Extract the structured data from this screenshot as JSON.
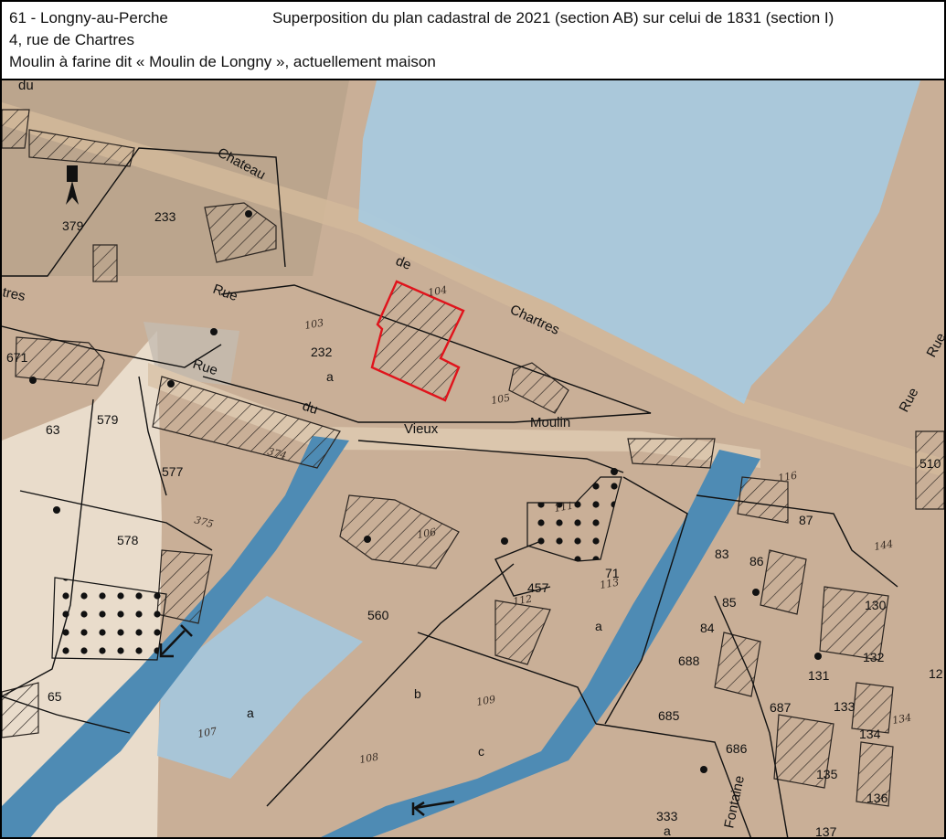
{
  "header": {
    "commune": "61 - Longny-au-Perche",
    "address": "4, rue de Chartres",
    "description": "Moulin à farine dit « Moulin de Longny »,  actuellement maison",
    "title": "Superposition du plan cadastral de 2021 (section AB) sur celui de 1831 (section I)"
  },
  "colors": {
    "paper": "#cbb39c",
    "paper_light": "#e8dccb",
    "river": "#4e8bb4",
    "pond": "#a9cbe0",
    "highlight": "#e0141c",
    "road": "#d8c0a4"
  },
  "streets": [
    "du",
    "Chateau",
    "Rue",
    "de",
    "Chartres",
    "tres",
    "Rue",
    "du",
    "Vieux",
    "Moulin",
    "Rue",
    "Fontaine",
    "Rue"
  ],
  "parcels_2021": [
    "379",
    "233",
    "232",
    "a",
    "671",
    "63",
    "579",
    "577",
    "578",
    "65",
    "a",
    "560",
    "b",
    "c",
    "457",
    "71",
    "a",
    "83",
    "86",
    "87",
    "85",
    "84",
    "688",
    "685",
    "686",
    "687",
    "131",
    "133",
    "132",
    "134",
    "135",
    "136",
    "130",
    "333",
    "a",
    "137",
    "510",
    "12"
  ],
  "parcels_1831": [
    "104",
    "103",
    "105",
    "375",
    "374",
    "106",
    "111",
    "113",
    "112",
    "109",
    "107",
    "108",
    "116",
    "134",
    "144"
  ],
  "north_arrow": "north-arrow-icon",
  "flow_arrows": [
    "arrow-left-icon",
    "arrow-southwest-icon"
  ]
}
